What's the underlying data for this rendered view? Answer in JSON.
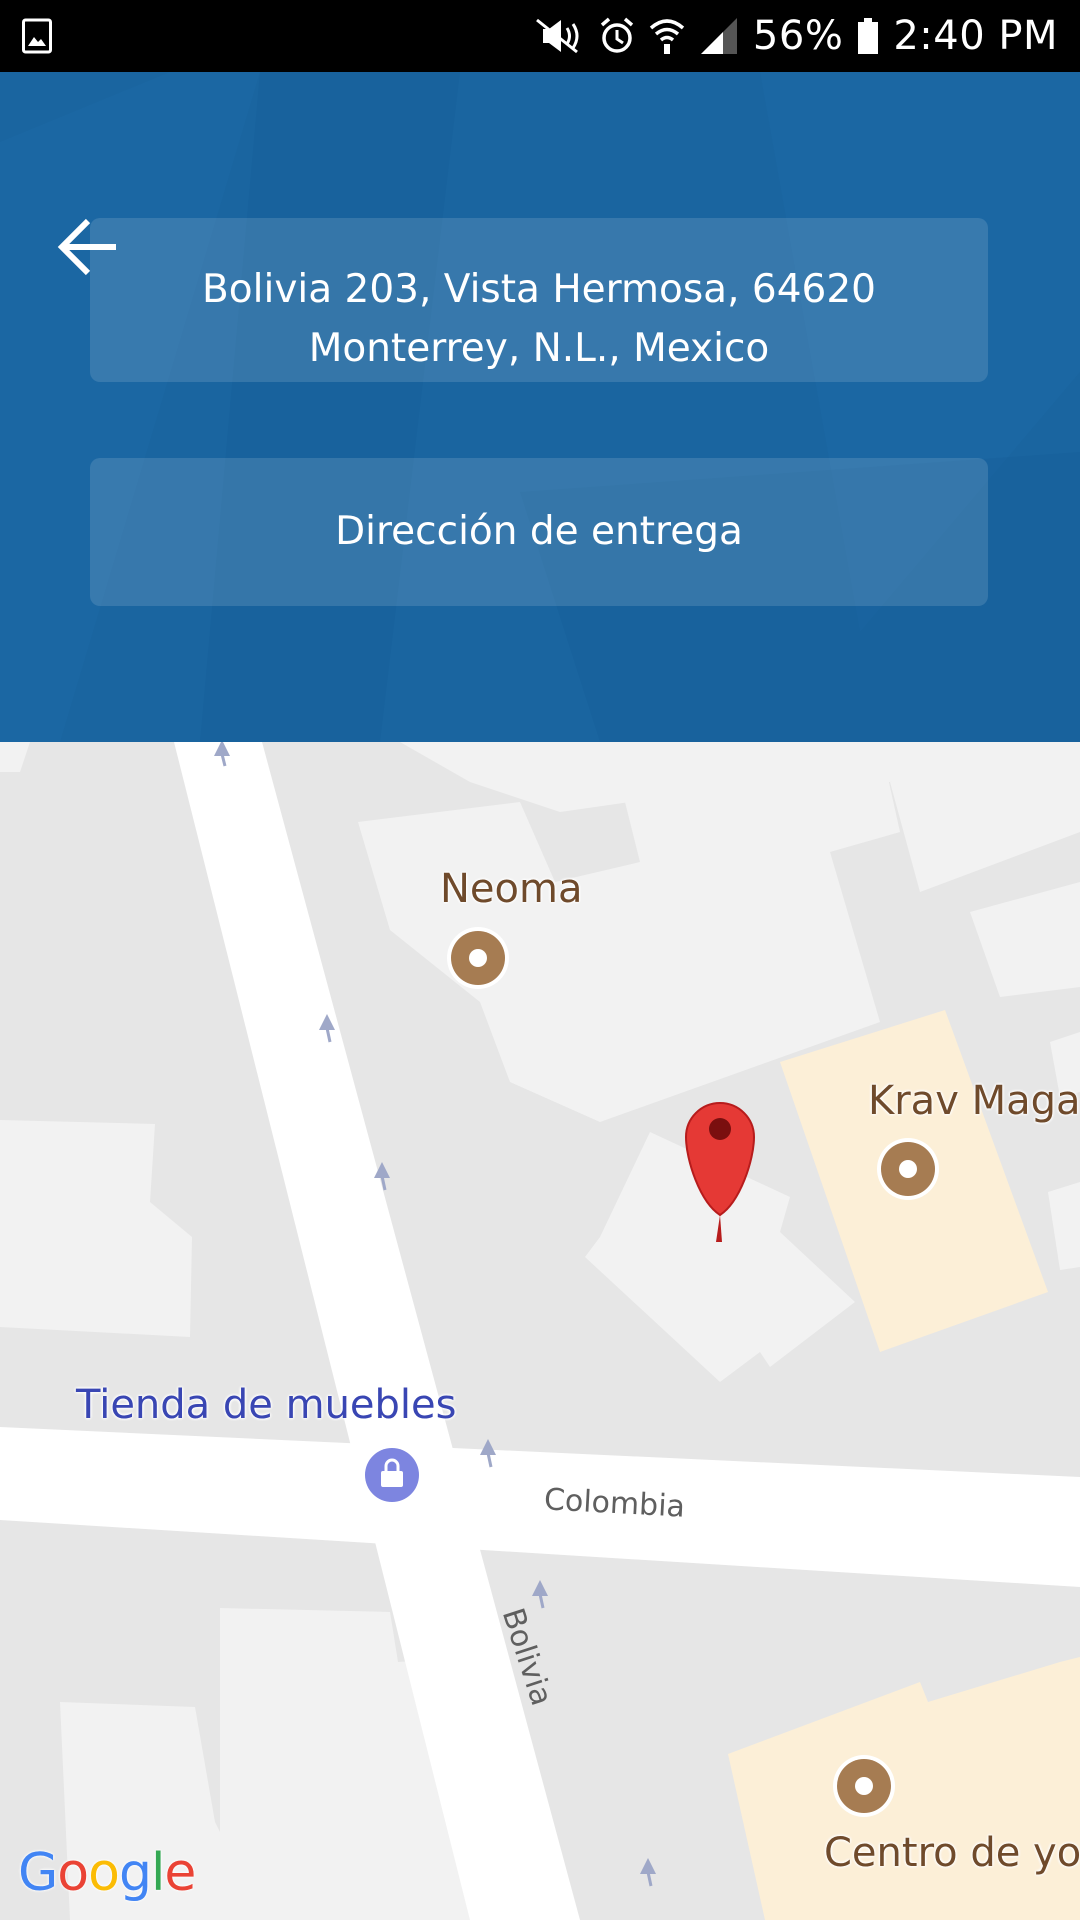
{
  "status_bar": {
    "battery_percent": "56%",
    "time": "2:40 PM",
    "icons": [
      "gallery-icon",
      "mute-icon",
      "alarm-icon",
      "wifi-icon",
      "signal-icon",
      "battery-icon"
    ]
  },
  "header": {
    "back_icon": "arrow-left-icon",
    "address_line1": "Bolivia 203, Vista Hermosa, 64620",
    "address_line2": "Monterrey, N.L., Mexico",
    "delivery_button_label": "Dirección de entrega"
  },
  "map": {
    "pois": [
      {
        "name": "Neoma",
        "category": "service"
      },
      {
        "name": "Krav Maga",
        "category": "service"
      },
      {
        "name": "Tienda de muebles",
        "category": "shopping"
      },
      {
        "name": "Centro de yog",
        "category": "service"
      }
    ],
    "streets": [
      "Colombia",
      "Bolivia"
    ],
    "attribution": "Google",
    "marker": "red-location-pin-icon"
  },
  "colors": {
    "header_blue": "#1a65a0",
    "map_background": "#e6e6e6",
    "building": "#f2f2f2",
    "poi_area": "#fcefd7",
    "poi_brown": "#a67c52",
    "poi_blue": "#7d85e0",
    "marker_red": "#e53935"
  }
}
